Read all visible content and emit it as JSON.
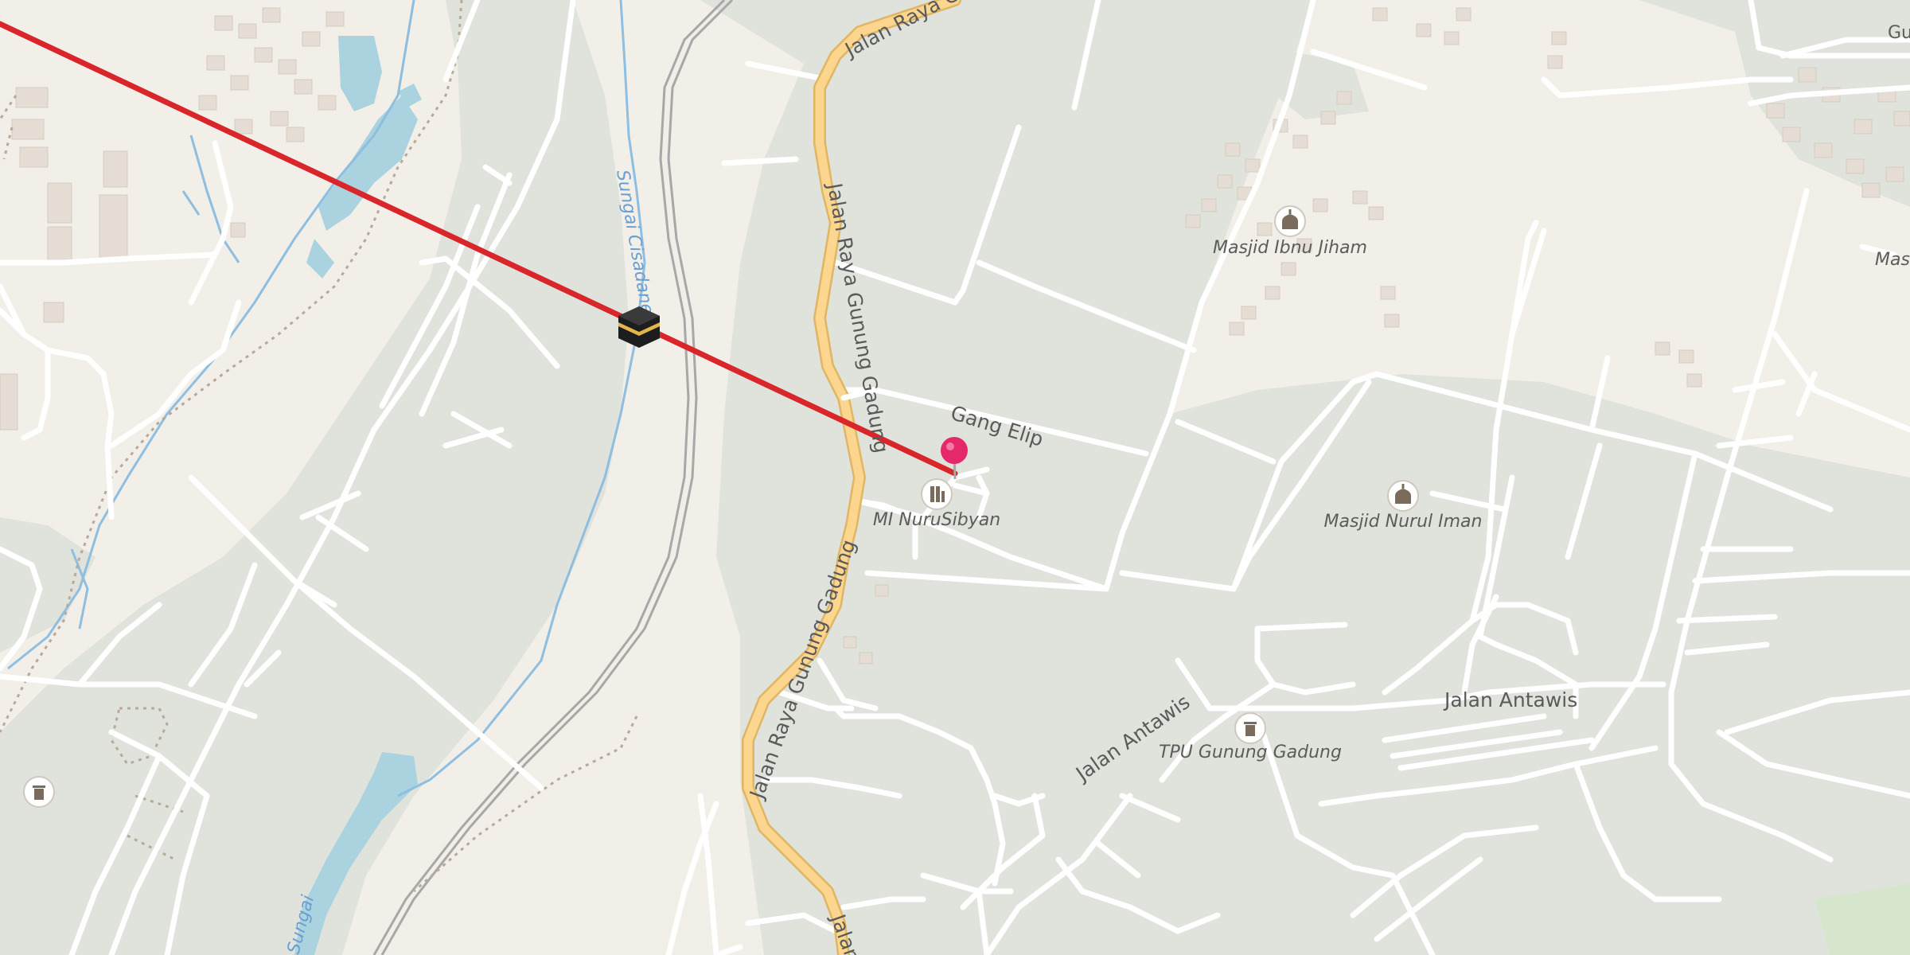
{
  "map": {
    "colors": {
      "background": "#f2efe9",
      "vegetation": "#dfe3dc",
      "road": "#ffffff",
      "primary_road": "#fcd68f",
      "primary_road_casing": "#e0b664",
      "water": "#aad3df",
      "building": "#e5ddd3",
      "route_line": "#d8262b",
      "pin": "#e4286b"
    },
    "roads": {
      "raya_top": "Jalan Raya Gu",
      "raya_mid": "Jalan Raya Gunung Gadung",
      "raya_south": "Jalan Raya Gunung Gadung",
      "raya_bottom": "Jalan",
      "gang_elip": "Gang Elip",
      "antawis_west": "Jalan Antawis",
      "antawis_east": "Jalan Antawis"
    },
    "waterways": {
      "north": "Sungai Cisadane",
      "south": "Sungai"
    },
    "pois": [
      {
        "label": "Masjid Ibnu Jiham",
        "icon": "mosque-icon"
      },
      {
        "label": "MI NuruSibyan",
        "icon": "school-icon"
      },
      {
        "label": "Masjid Nurul Iman",
        "icon": "mosque-icon"
      },
      {
        "label": "TPU Gunung Gadung",
        "icon": "cemetery-icon"
      }
    ],
    "edge_labels": {
      "top_right": "Gu",
      "right": "Mas"
    },
    "markers": {
      "kaaba": "kaaba-icon",
      "pin": "location-pin-icon",
      "route": "qibla-direction-line"
    }
  }
}
